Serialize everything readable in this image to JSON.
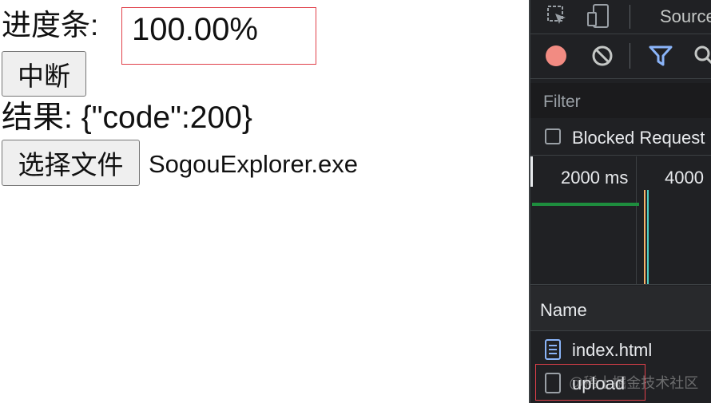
{
  "page": {
    "progress_label": "进度条:",
    "progress_value": "100.00%",
    "abort_button": "中断",
    "result_text": "结果: {\"code\":200}",
    "choose_file_button": "选择文件",
    "file_name": "SogouExplorer.exe"
  },
  "devtools": {
    "tab_sources": "Source",
    "filter_placeholder": "Filter",
    "blocked_requests_label": "Blocked Request",
    "timeline_ticks": [
      "2000 ms",
      "4000"
    ],
    "name_header": "Name",
    "requests": [
      {
        "name": "index.html",
        "icon": "document-icon"
      },
      {
        "name": "upload",
        "icon": "blank-file-icon"
      }
    ],
    "watermark": "@稀土掘金技术社区"
  },
  "colors": {
    "record": "#f28b82",
    "filter_active": "#8ab4f8",
    "highlight_border": "#e0404a",
    "timeline_green": "#1e8e3e",
    "timeline_orange": "#f5b36b",
    "timeline_teal": "#4fd1c5"
  }
}
